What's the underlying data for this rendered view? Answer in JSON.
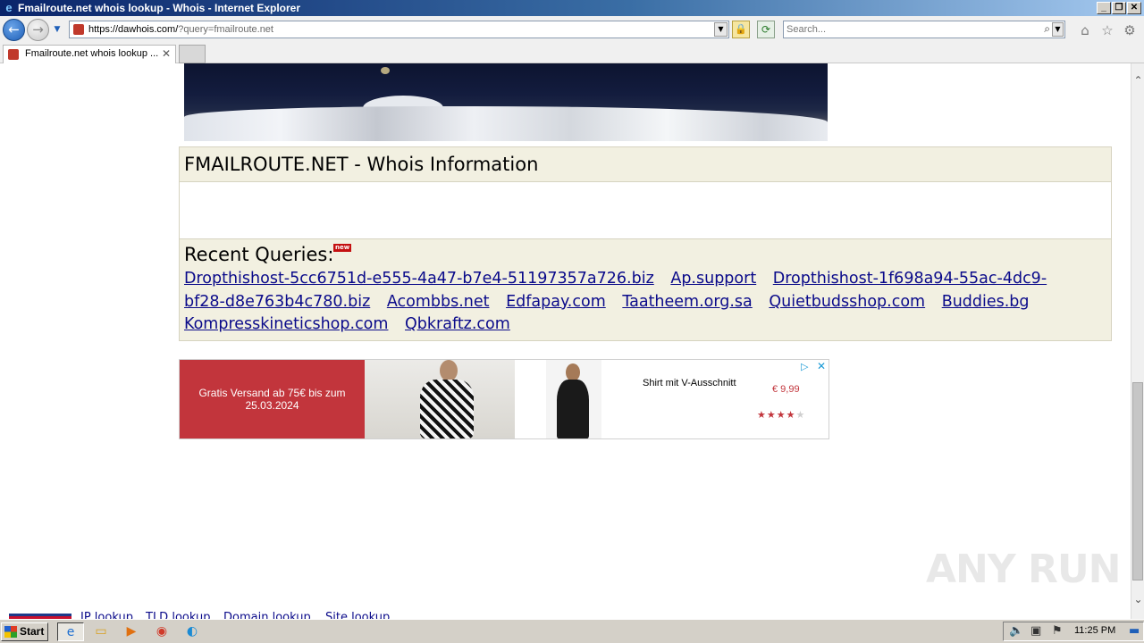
{
  "window": {
    "title": "Fmailroute.net whois lookup - Whois - Internet Explorer"
  },
  "address_bar": {
    "url_host": "https://dawhois.com/",
    "url_query": "?query=fmailroute.net"
  },
  "search_box": {
    "placeholder": "Search..."
  },
  "tab": {
    "label": "Fmailroute.net whois lookup ..."
  },
  "page": {
    "section_title": "FMAILROUTE.NET - Whois Information",
    "recent_title": "Recent Queries:",
    "new_badge": "new",
    "recent_queries": [
      "Dropthishost-5cc6751d-e555-4a47-b7e4-51197357a726.biz",
      "Ap.support",
      "Dropthishost-1f698a94-55ac-4dc9-bf28-d8e763b4c780.biz",
      "Acombbs.net",
      "Edfapay.com",
      "Taatheem.org.sa",
      "Quietbudsshop.com",
      "Buddies.bg",
      "Kompresskineticshop.com",
      "Qbkraftz.com"
    ],
    "footer_links": [
      "IP lookup",
      "TLD lookup",
      "Domain lookup",
      "Site lookup"
    ]
  },
  "ad": {
    "promo_text": "Gratis Versand ab 75€ bis zum 25.03.2024",
    "product_name": "Shirt mit V-Ausschnitt",
    "price": "€ 9,99",
    "rating": 4,
    "rating_max": 5,
    "accent_color": "#c2353c"
  },
  "watermark": "ANY RUN",
  "taskbar": {
    "start_label": "Start",
    "clock": "11:25 PM",
    "apps": [
      "internet-explorer",
      "file-explorer",
      "media-player",
      "chrome",
      "edge"
    ]
  }
}
